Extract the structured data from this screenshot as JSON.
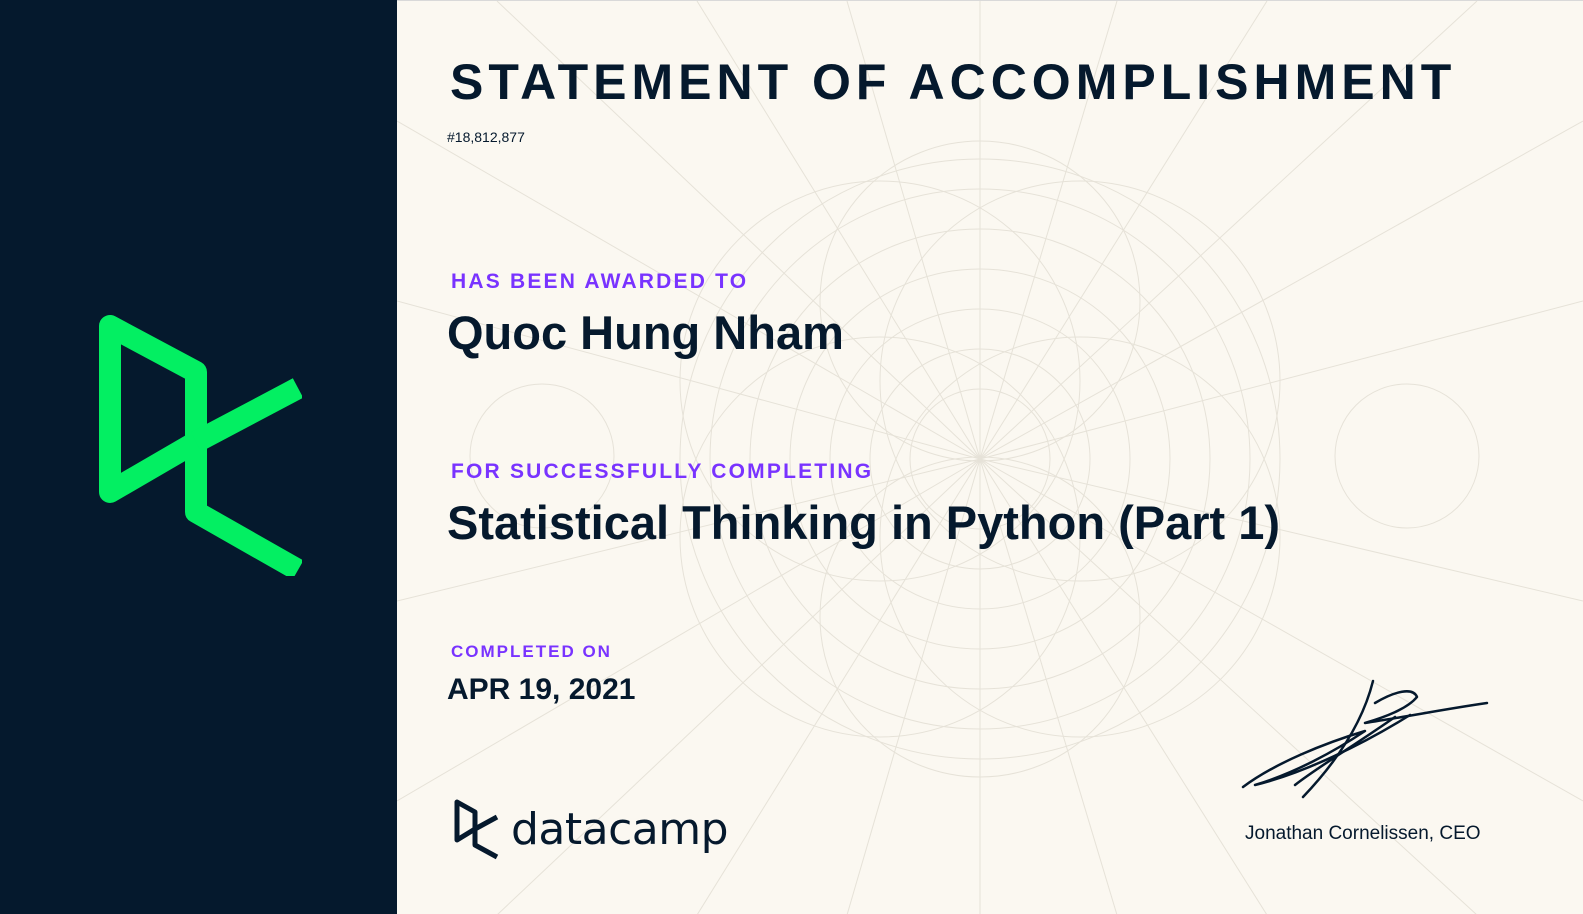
{
  "certificate": {
    "title": "STATEMENT OF ACCOMPLISHMENT",
    "id": "#18,812,877",
    "awarded_label": "HAS BEEN AWARDED TO",
    "recipient": "Quoc Hung Nham",
    "completing_label": "FOR SUCCESSFULLY COMPLETING",
    "course": "Statistical Thinking in Python (Part 1)",
    "completed_label": "COMPLETED ON",
    "date": "APR 19, 2021",
    "signer": "Jonathan Cornelissen, CEO"
  },
  "brand": {
    "name": "datacamp",
    "logo_icon": "datacamp-logo-icon"
  },
  "colors": {
    "sidebar": "#05192d",
    "logo_green": "#03ef62",
    "accent_purple": "#7933ff",
    "text_dark": "#05192d",
    "paper": "#fbf8f1"
  }
}
